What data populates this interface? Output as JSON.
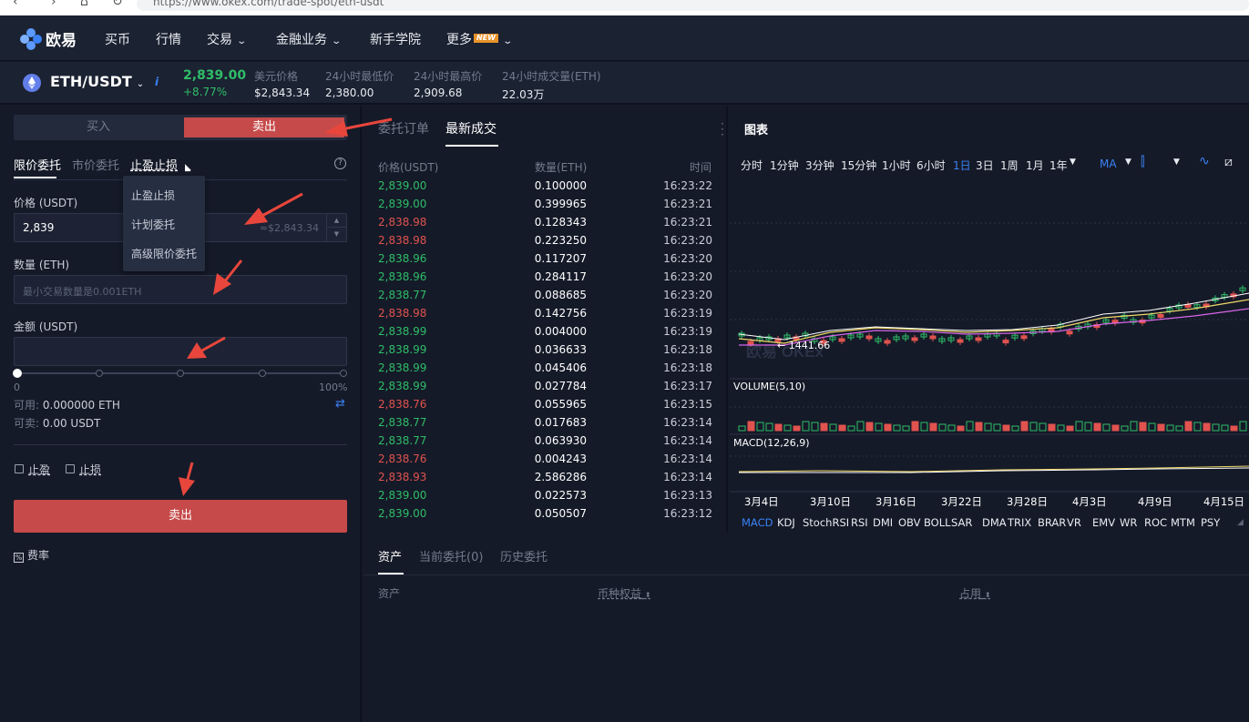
{
  "browser": {
    "url": "https://www.okex.com/trade-spot/eth-usdt"
  },
  "nav": {
    "brand": "欧易",
    "items": [
      {
        "label": "买币",
        "chevron": false,
        "badge": ""
      },
      {
        "label": "行情",
        "chevron": false,
        "badge": ""
      },
      {
        "label": "交易",
        "chevron": true,
        "badge": ""
      },
      {
        "label": "金融业务",
        "chevron": true,
        "badge": ""
      },
      {
        "label": "新手学院",
        "chevron": false,
        "badge": ""
      },
      {
        "label": "更多",
        "chevron": true,
        "badge": "NEW"
      }
    ]
  },
  "ticker": {
    "pair": "ETH/USDT",
    "info_icon": "i",
    "price": "2,839.00",
    "change": "+8.77%",
    "stats": [
      {
        "label": "美元价格",
        "value": "$2,843.34"
      },
      {
        "label": "24小时最低价",
        "value": "2,380.00"
      },
      {
        "label": "24小时最高价",
        "value": "2,909.68"
      },
      {
        "label": "24小时成交量(ETH)",
        "value": "22.03万"
      }
    ]
  },
  "trade": {
    "buy_tab": "买入",
    "sell_tab": "卖出",
    "order_tabs": [
      "限价委托",
      "市价委托",
      "止盈止损"
    ],
    "dropdown": [
      "止盈止损",
      "计划委托",
      "高级限价委托"
    ],
    "price_label": "价格 (USDT)",
    "price_value": "2,839",
    "price_approx": "≈$2,843.34",
    "qty_label": "数量 (ETH)",
    "qty_placeholder": "最小交易数量是0.001ETH",
    "amount_label": "金额 (USDT)",
    "slider_min": "0",
    "slider_max": "100%",
    "slider_value": 0,
    "available_label": "可用:",
    "available_value": "0.000000 ETH",
    "sellable_label": "可卖:",
    "sellable_value": "0.00 USDT",
    "take_profit": "止盈",
    "stop_loss": "止损",
    "submit": "卖出",
    "fee": "费率"
  },
  "orderbook": {
    "tabs": [
      "委托订单",
      "最新成交"
    ],
    "headers": [
      "价格(USDT)",
      "数量(ETH)",
      "时间"
    ],
    "rows": [
      {
        "price": "2,839.00",
        "qty": "0.100000",
        "time": "16:23:22",
        "side": "up"
      },
      {
        "price": "2,839.00",
        "qty": "0.399965",
        "time": "16:23:21",
        "side": "up"
      },
      {
        "price": "2,838.98",
        "qty": "0.128343",
        "time": "16:23:21",
        "side": "down"
      },
      {
        "price": "2,838.98",
        "qty": "0.223250",
        "time": "16:23:20",
        "side": "down"
      },
      {
        "price": "2,838.96",
        "qty": "0.117207",
        "time": "16:23:20",
        "side": "up"
      },
      {
        "price": "2,838.96",
        "qty": "0.284117",
        "time": "16:23:20",
        "side": "up"
      },
      {
        "price": "2,838.77",
        "qty": "0.088685",
        "time": "16:23:20",
        "side": "up"
      },
      {
        "price": "2,838.98",
        "qty": "0.142756",
        "time": "16:23:19",
        "side": "down"
      },
      {
        "price": "2,838.99",
        "qty": "0.004000",
        "time": "16:23:19",
        "side": "up"
      },
      {
        "price": "2,838.99",
        "qty": "0.036633",
        "time": "16:23:18",
        "side": "up"
      },
      {
        "price": "2,838.99",
        "qty": "0.045406",
        "time": "16:23:18",
        "side": "up"
      },
      {
        "price": "2,838.99",
        "qty": "0.027784",
        "time": "16:23:17",
        "side": "up"
      },
      {
        "price": "2,838.76",
        "qty": "0.055965",
        "time": "16:23:15",
        "side": "down"
      },
      {
        "price": "2,838.77",
        "qty": "0.017683",
        "time": "16:23:14",
        "side": "up"
      },
      {
        "price": "2,838.77",
        "qty": "0.063930",
        "time": "16:23:14",
        "side": "up"
      },
      {
        "price": "2,838.76",
        "qty": "0.004243",
        "time": "16:23:14",
        "side": "down"
      },
      {
        "price": "2,838.93",
        "qty": "2.586286",
        "time": "16:23:14",
        "side": "down"
      },
      {
        "price": "2,839.00",
        "qty": "0.022573",
        "time": "16:23:13",
        "side": "up"
      },
      {
        "price": "2,839.00",
        "qty": "0.050507",
        "time": "16:23:12",
        "side": "up"
      }
    ]
  },
  "chart": {
    "title": "图表",
    "intervals": [
      "分时",
      "1分钟",
      "3分钟",
      "15分钟",
      "1小时",
      "6小时",
      "1日",
      "3日",
      "1周",
      "1月",
      "1年"
    ],
    "active_interval": "1日",
    "ma_label": "MA",
    "low_marker": "1441.66",
    "watermark": "欧易 OKEx",
    "volume_label": "VOLUME(5,10)",
    "macd_label": "MACD(12,26,9)",
    "dates": [
      "3月4日",
      "3月10日",
      "3月16日",
      "3月22日",
      "3月28日",
      "4月3日",
      "4月9日",
      "4月15日"
    ],
    "indicators": [
      "MACD",
      "KDJ",
      "StochRSI",
      "RSI",
      "DMI",
      "OBV",
      "BOLL",
      "SAR",
      "DMA",
      "TRIX",
      "BRAR",
      "VR",
      "EMV",
      "WR",
      "ROC",
      "MTM",
      "PSY"
    ],
    "colors": {
      "up": "#2fbd68",
      "down": "#e0534f",
      "accent": "#3b82f6"
    }
  },
  "assets": {
    "tabs": [
      "资产",
      "当前委托(0)",
      "历史委托"
    ],
    "headers": [
      "资产",
      "币种权益",
      "占用"
    ]
  }
}
